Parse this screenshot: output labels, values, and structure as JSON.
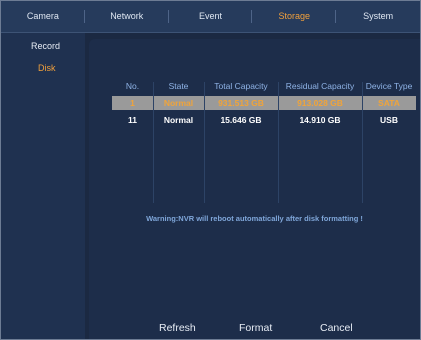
{
  "tabs": [
    "Camera",
    "Network",
    "Event",
    "Storage",
    "System"
  ],
  "active_tab": "Storage",
  "sidebar": {
    "items": [
      {
        "label": "Record"
      },
      {
        "label": "Disk"
      }
    ],
    "active": "Disk"
  },
  "table": {
    "headers": [
      "No.",
      "State",
      "Total Capacity",
      "Residual Capacity",
      "Device Type"
    ],
    "rows": [
      {
        "no": "1",
        "state": "Normal",
        "total": "931.513 GB",
        "residual": "913.028 GB",
        "type": "SATA",
        "selected": true
      },
      {
        "no": "11",
        "state": "Normal",
        "total": "15.646 GB",
        "residual": "14.910 GB",
        "type": "USB",
        "selected": false
      }
    ]
  },
  "warning": "Warning:NVR will reboot automatically after disk formatting !",
  "buttons": {
    "refresh": "Refresh",
    "format": "Format",
    "cancel": "Cancel"
  },
  "colors": {
    "accent": "#f1a03c",
    "header_text": "#8fb3e6",
    "warning_text": "#7fa6d9",
    "selected_row": "#9a9a9a"
  }
}
